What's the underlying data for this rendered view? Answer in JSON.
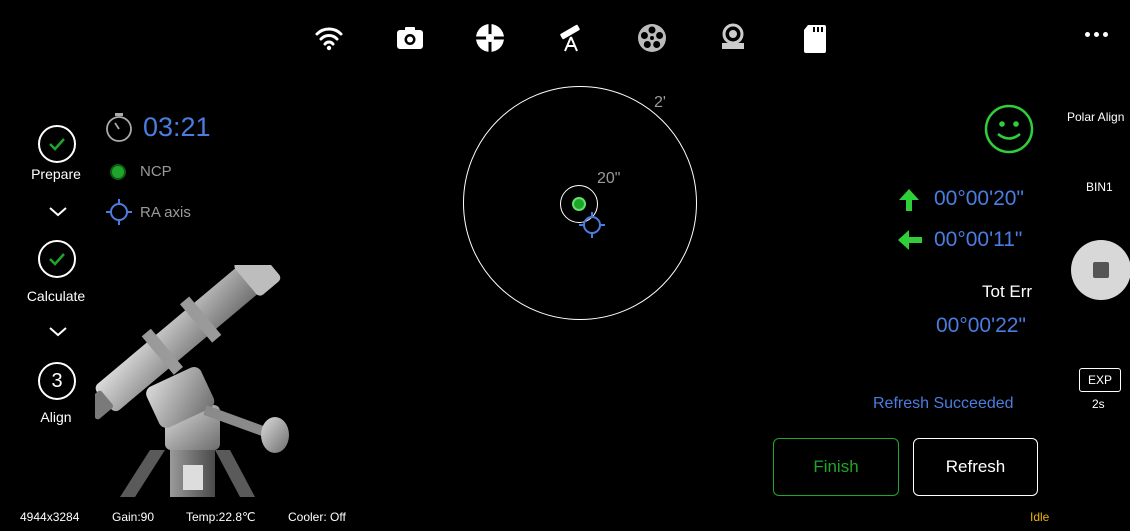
{
  "toolbar": {
    "icons": [
      "wifi-icon",
      "camera-icon",
      "crosshair-icon",
      "telescope-icon",
      "filter-wheel-icon",
      "focuser-icon",
      "sd-card-icon"
    ],
    "more": "more-icon"
  },
  "steps": {
    "prepare": "Prepare",
    "calculate": "Calculate",
    "align_number": "3",
    "align": "Align"
  },
  "timer": "03:21",
  "ncp_label": "NCP",
  "ra_axis_label": "RA axis",
  "target": {
    "outer_label": "2'",
    "inner_label": "20\""
  },
  "status_face": "smiley-icon",
  "errors": {
    "alt": "00°00'20\"",
    "az": "00°00'11\"",
    "tot_label": "Tot Err",
    "tot": "00°00'22\""
  },
  "refresh_status": "Refresh Succeeded",
  "buttons": {
    "finish": "Finish",
    "refresh": "Refresh"
  },
  "sidebar": {
    "mode": "Polar Align",
    "bin": "BIN1",
    "exp_label": "EXP",
    "exp_value": "2s"
  },
  "statusbar": {
    "resolution": "4944x3284",
    "gain": "Gain:90",
    "temp": "Temp:22.8℃",
    "cooler": "Cooler: Off",
    "state": "Idle"
  },
  "colors": {
    "accent_blue": "#4a7de0",
    "accent_green": "#1fa52a",
    "idle_yellow": "#e9b300"
  }
}
